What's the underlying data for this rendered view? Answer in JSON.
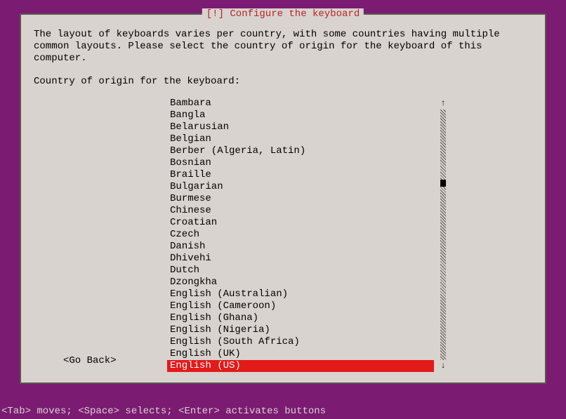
{
  "dialog": {
    "title": "[!] Configure the keyboard",
    "instruction": "The layout of keyboards varies per country, with some countries having multiple common layouts. Please select the country of origin for the keyboard of this computer.",
    "prompt": "Country of origin for the keyboard:",
    "items": [
      "Bambara",
      "Bangla",
      "Belarusian",
      "Belgian",
      "Berber (Algeria, Latin)",
      "Bosnian",
      "Braille",
      "Bulgarian",
      "Burmese",
      "Chinese",
      "Croatian",
      "Czech",
      "Danish",
      "Dhivehi",
      "Dutch",
      "Dzongkha",
      "English (Australian)",
      "English (Cameroon)",
      "English (Ghana)",
      "English (Nigeria)",
      "English (South Africa)",
      "English (UK)",
      "English (US)"
    ],
    "selected_index": 22,
    "go_back": "<Go Back>"
  },
  "help": "<Tab> moves; <Space> selects; <Enter> activates buttons"
}
